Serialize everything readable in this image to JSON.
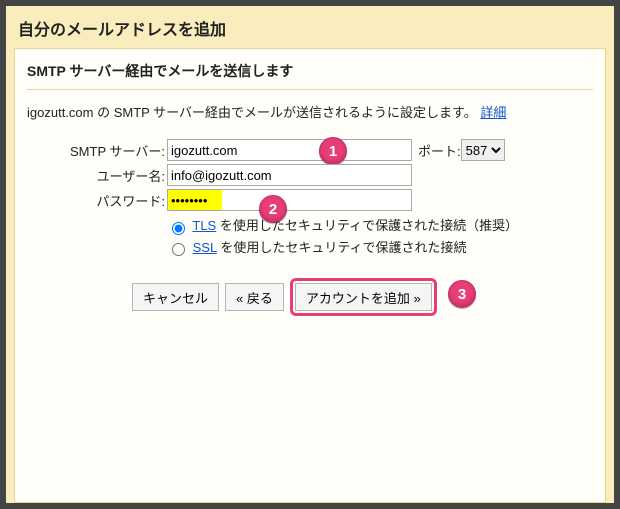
{
  "window_title": "自分のメールアドレスを追加",
  "subtitle": "SMTP サーバー経由でメールを送信します",
  "description_text": "igozutt.com の SMTP サーバー経由でメールが送信されるように設定します。",
  "detail_link": "詳細",
  "labels": {
    "smtp": "SMTP サーバー:",
    "user": "ユーザー名:",
    "pass": "パスワード:",
    "port": "ポート:"
  },
  "values": {
    "smtp": "igozutt.com",
    "user": "info@igozutt.com",
    "pass": "••••••••",
    "port": "587"
  },
  "security": {
    "tls_link": "TLS",
    "tls_rest": " を使用したセキュリティで保護された接続（推奨）",
    "ssl_link": "SSL",
    "ssl_rest": " を使用したセキュリティで保護された接続"
  },
  "buttons": {
    "cancel": "キャンセル",
    "back": "« 戻る",
    "add": "アカウントを追加 »"
  },
  "callouts": {
    "c1": "1",
    "c2": "2",
    "c3": "3"
  }
}
